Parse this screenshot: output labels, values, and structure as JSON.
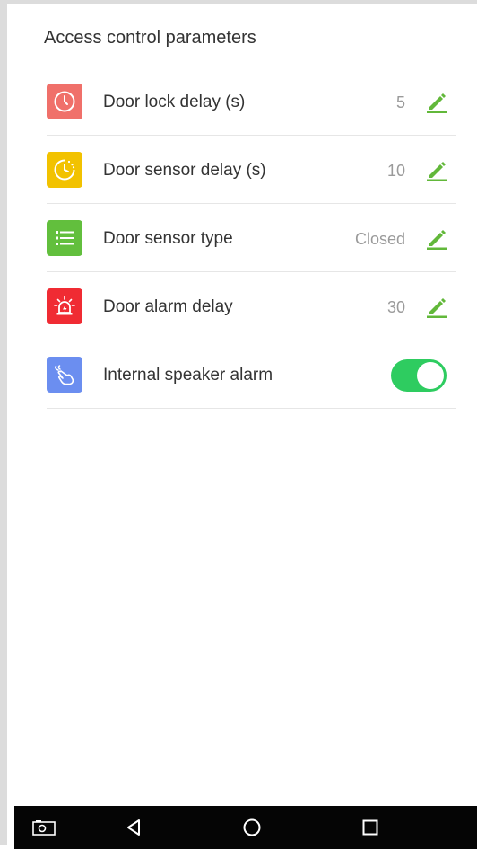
{
  "header": {
    "title": "Access control parameters"
  },
  "rows": [
    {
      "label": "Door lock delay (s)",
      "value": "5",
      "icon": "clock-icon",
      "icon_color": "#f0706a"
    },
    {
      "label": "Door sensor delay (s)",
      "value": "10",
      "icon": "timer-icon",
      "icon_color": "#f2c200"
    },
    {
      "label": "Door sensor type",
      "value": "Closed",
      "icon": "list-icon",
      "icon_color": "#62bf3d"
    },
    {
      "label": "Door alarm delay",
      "value": "30",
      "icon": "siren-icon",
      "icon_color": "#f02b33"
    },
    {
      "label": "Internal speaker alarm",
      "icon": "hand-icon",
      "icon_color": "#6b8ef0",
      "toggle_on": true
    }
  ],
  "colors": {
    "accent_green": "#2ecc60",
    "edit_icon": "#62b83a"
  },
  "navbar": {
    "items": [
      "screenshot-icon",
      "back-icon",
      "home-icon",
      "recents-icon"
    ]
  }
}
